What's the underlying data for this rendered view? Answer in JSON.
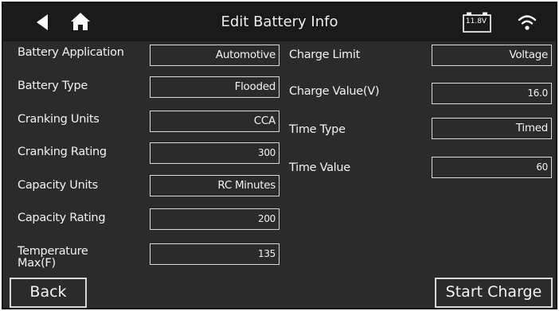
{
  "header": {
    "title": "Edit Battery Info",
    "battery_voltage": "11.8V",
    "back_icon": "back-arrow-icon",
    "home_icon": "home-icon",
    "wifi_icon": "wifi-icon"
  },
  "left_fields": [
    {
      "label": "Battery Application",
      "value": "Automotive"
    },
    {
      "label": "Battery Type",
      "value": "Flooded"
    },
    {
      "label": "Cranking Units",
      "value": "CCA"
    },
    {
      "label": "Cranking Rating",
      "value": "300"
    },
    {
      "label": "Capacity Units",
      "value": "RC Minutes"
    },
    {
      "label": "Capacity Rating",
      "value": "200"
    },
    {
      "label": "Temperature Max(F)",
      "value": "135"
    }
  ],
  "right_fields": [
    {
      "label": "Charge Limit",
      "value": "Voltage"
    },
    {
      "label": "Charge Value(V)",
      "value": "16.0"
    },
    {
      "label": "Time Type",
      "value": "Timed"
    },
    {
      "label": "Time Value",
      "value": "60"
    }
  ],
  "buttons": {
    "back": "Back",
    "start_charge": "Start Charge"
  }
}
